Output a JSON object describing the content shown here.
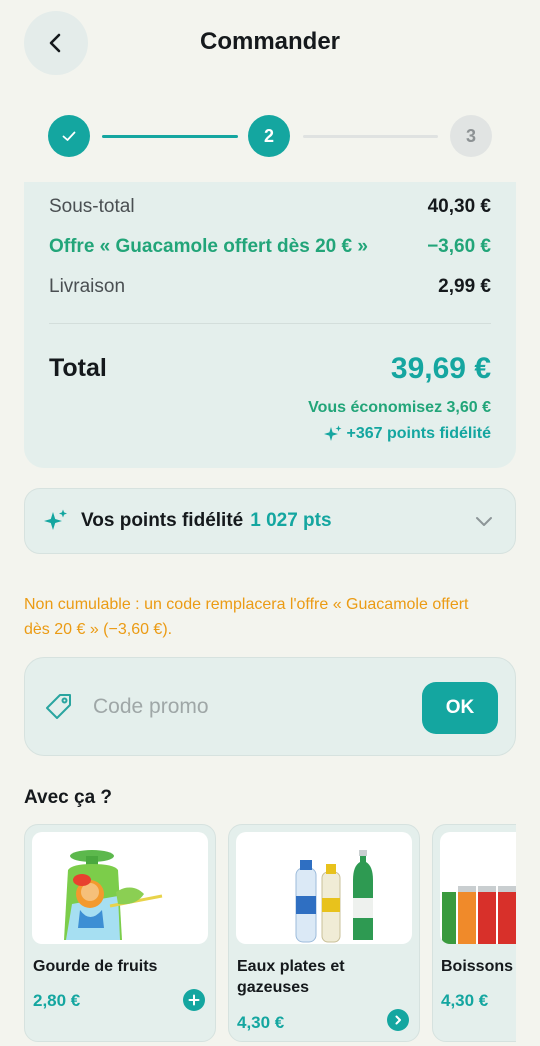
{
  "header": {
    "title": "Commander",
    "back_icon": "chevron-left-icon"
  },
  "stepper": {
    "step1_icon": "check-icon",
    "step2_label": "2",
    "step3_label": "3"
  },
  "summary": {
    "subtotal_label": "Sous-total",
    "subtotal_value": "40,30 €",
    "offer_label": "Offre « Guacamole offert dès 20 € »",
    "offer_value": "−3,60 €",
    "delivery_label": "Livraison",
    "delivery_value": "2,99 €",
    "total_label": "Total",
    "total_value": "39,69 €",
    "savings_text": "Vous économisez 3,60 €",
    "points_earned_text": "+367 points fidélité"
  },
  "loyalty": {
    "label": "Vos points fidélité",
    "points": "1 027 pts"
  },
  "warning_text": "Non cumulable : un code remplacera l'offre « Guacamole offert dès 20 € » (−3,60 €).",
  "promo": {
    "placeholder": "Code promo",
    "ok_label": "OK"
  },
  "suggestions": {
    "title": "Avec ça ?",
    "items": [
      {
        "name": "Gourde de fruits",
        "price": "2,80 €",
        "action_icon": "plus-icon"
      },
      {
        "name": "Eaux plates et gazeuses",
        "price": "4,30 €",
        "action_icon": "chevron-right-icon"
      },
      {
        "name": "Boissons",
        "price": "4,30 €"
      }
    ]
  },
  "colors": {
    "accent": "#14a6a0",
    "green": "#22a579",
    "warning": "#eb9b14",
    "card": "#e4efec",
    "background": "#f3f4ee"
  }
}
